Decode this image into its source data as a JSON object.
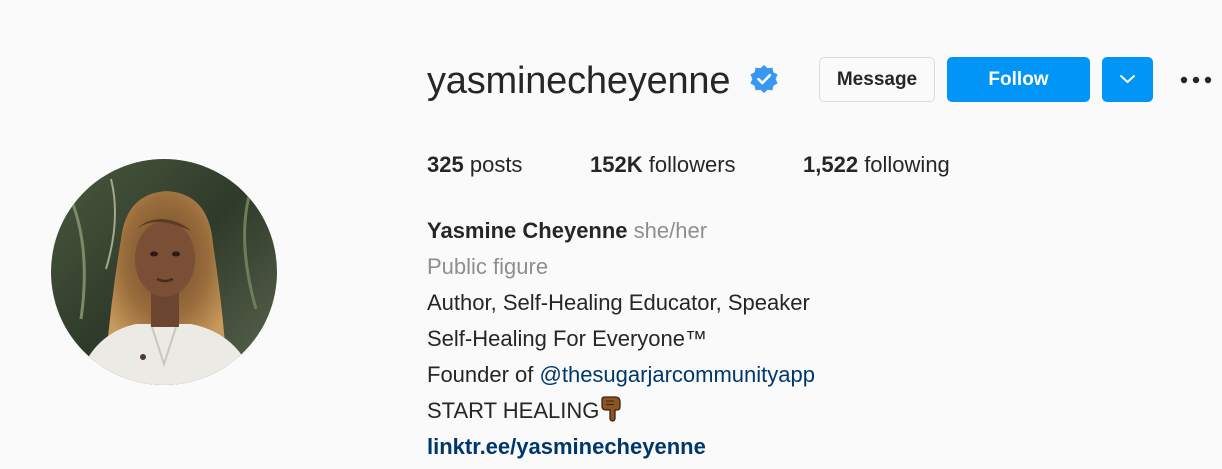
{
  "profile": {
    "username": "yasminecheyenne",
    "verified_icon": "verified-badge-icon",
    "buttons": {
      "message": "Message",
      "follow": "Follow",
      "dropdown_icon": "chevron-down-icon",
      "more_icon": "more-options-icon"
    },
    "stats": {
      "posts_count": "325",
      "posts_label": "posts",
      "followers_count": "152K",
      "followers_label": "followers",
      "following_count": "1,522",
      "following_label": "following"
    },
    "bio": {
      "full_name": "Yasmine Cheyenne",
      "pronouns": "she/her",
      "category": "Public figure",
      "line1": "Author, Self-Healing Educator, Speaker",
      "line2": "Self-Healing For Everyone™",
      "line3_prefix": "Founder of ",
      "line3_mention": "@thesugarjarcommunityapp",
      "line4": "START HEALING",
      "line4_emoji": "pointing-down-hand-icon",
      "link": "linktr.ee/yasminecheyenne"
    }
  },
  "colors": {
    "background": "#fafafa",
    "text": "#262626",
    "muted": "#8e8e8e",
    "accent": "#0095f6",
    "link": "#00376b",
    "verified": "#3897f0"
  }
}
